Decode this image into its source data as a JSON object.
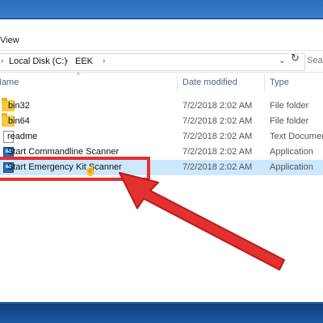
{
  "explorer": {
    "ribbon_tab": "View",
    "address": {
      "crumbs": [
        "Local Disk (C:)",
        "EEK"
      ],
      "separator": "›",
      "dropdown_icon": "chevron-down-icon",
      "refresh_icon": "refresh-icon",
      "search_placeholder": "Sea"
    },
    "columns": {
      "name": "Name",
      "date": "Date modified",
      "type": "Type"
    },
    "files": [
      {
        "name": "bin32",
        "date": "7/2/2018 2:02 AM",
        "type": "File folder",
        "icon": "folder-icon"
      },
      {
        "name": "bin64",
        "date": "7/2/2018 2:02 AM",
        "type": "File folder",
        "icon": "folder-icon"
      },
      {
        "name": "readme",
        "date": "7/2/2018 2:02 AM",
        "type": "Text Documen",
        "icon": "text-file-icon"
      },
      {
        "name": "Start Commandline Scanner",
        "date": "7/2/2018 2:02 AM",
        "type": "Application",
        "icon": "application-icon"
      },
      {
        "name": "Start Emergency Kit Scanner",
        "date": "7/2/2018 2:02 AM",
        "type": "Application",
        "icon": "application-icon"
      }
    ],
    "colors": {
      "highlight": "#e53030",
      "selection": "#cce8ff",
      "desktop": "#1f5fa8"
    }
  }
}
